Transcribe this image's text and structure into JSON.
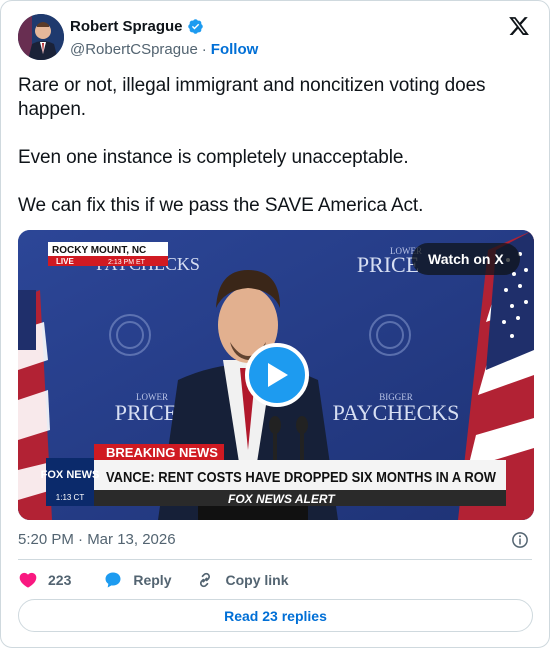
{
  "author": {
    "name": "Robert Sprague",
    "handle": "@RobertCSprague",
    "separator": "·",
    "follow_label": "Follow"
  },
  "tweet": {
    "paragraphs": [
      "Rare or not, illegal immigrant and noncitizen voting does happen.",
      "Even one instance is completely unacceptable.",
      "We can fix this if we pass the SAVE America Act."
    ]
  },
  "media": {
    "watch_label": "Watch on X",
    "location_label": "ROCKY MOUNT, NC",
    "live_label": "LIVE",
    "time_label": "2:13 PM ET",
    "backdrop_words": [
      "LOWER",
      "PRICES",
      "BIGGER",
      "PAYCHECKS"
    ],
    "breaking_label": "BREAKING NEWS",
    "headline": "VANCE: RENT COSTS HAVE DROPPED SIX MONTHS IN A ROW",
    "alert_label": "FOX NEWS ALERT",
    "network_logo": "FOX NEWS",
    "network_time": "1:13 CT"
  },
  "meta": {
    "timestamp": "5:20 PM · Mar 13, 2026"
  },
  "actions": {
    "like_count": "223",
    "reply_label": "Reply",
    "copy_label": "Copy link",
    "read_replies": "Read 23 replies"
  },
  "colors": {
    "accent": "#1d9bf0",
    "link": "#006fd6",
    "like": "#f91880",
    "fox_red": "#d01a22"
  }
}
